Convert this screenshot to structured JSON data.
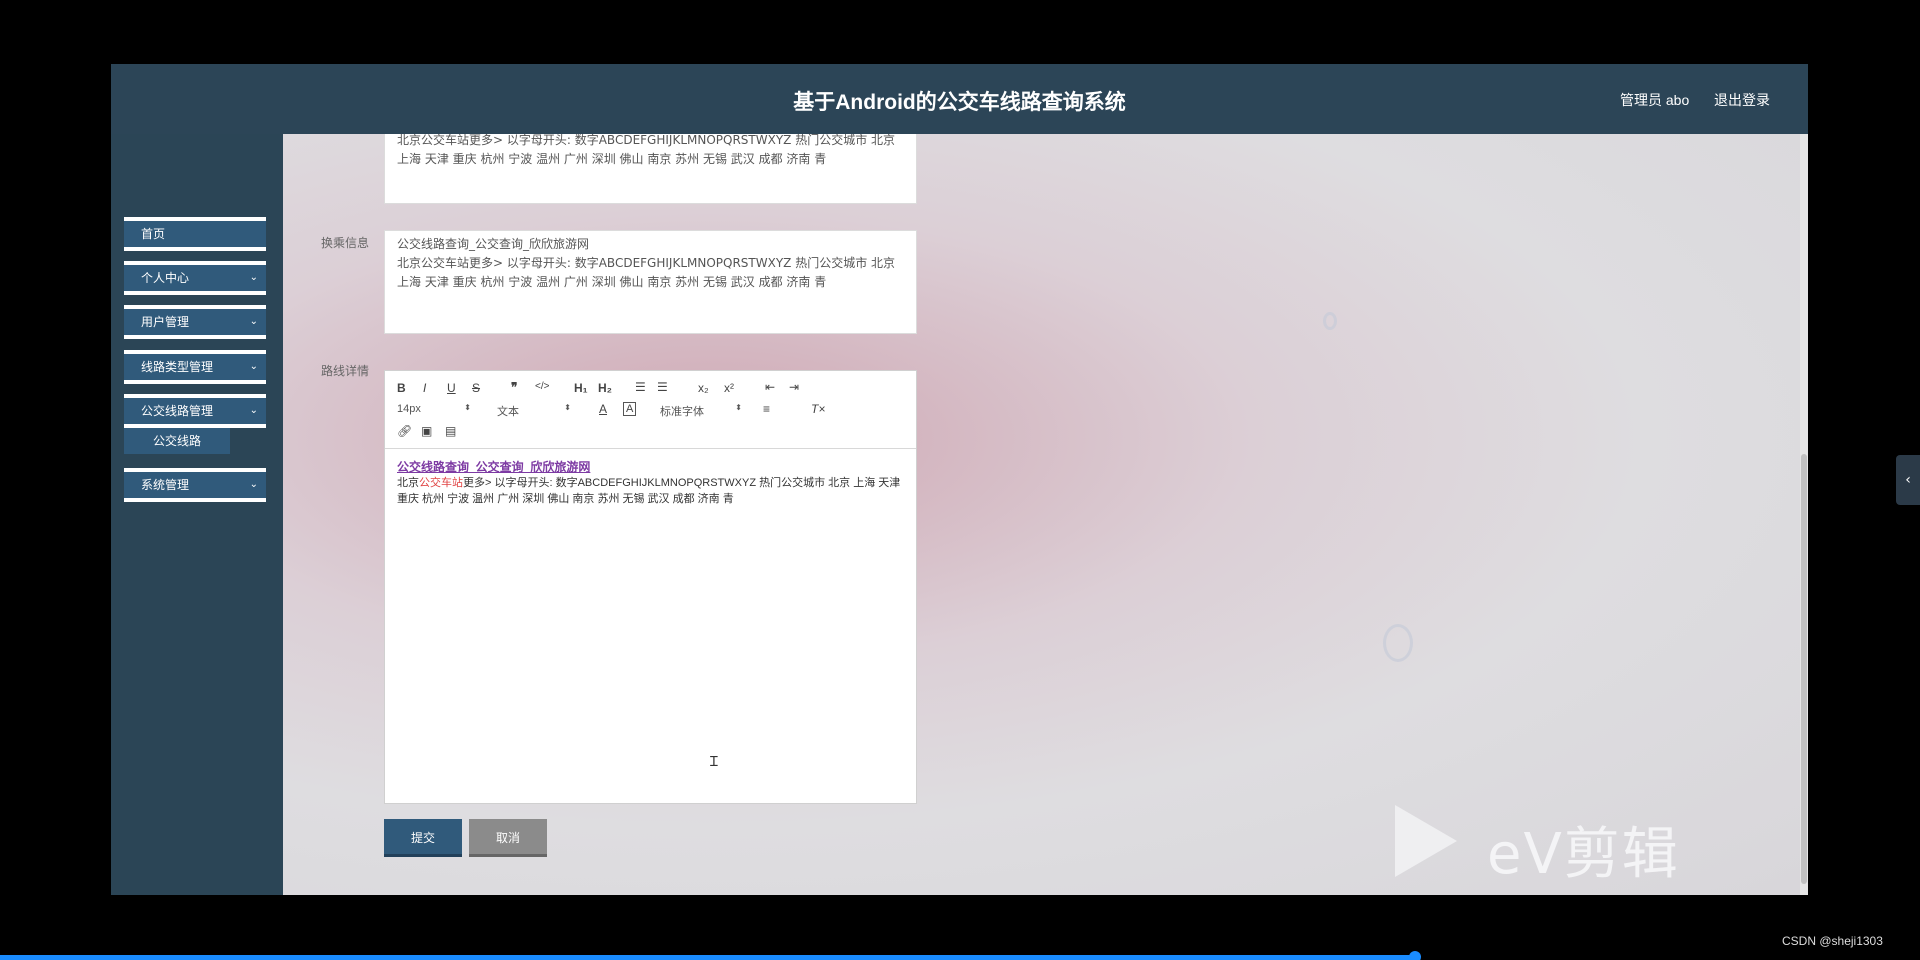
{
  "header": {
    "title": "基于Android的公交车线路查询系统",
    "user": "管理员 abo",
    "logout": "退出登录"
  },
  "sidebar": {
    "items": [
      {
        "label": "首页"
      },
      {
        "label": "个人中心"
      },
      {
        "label": "用户管理"
      },
      {
        "label": "线路类型管理"
      },
      {
        "label": "公交线路管理"
      },
      {
        "label": "系统管理"
      }
    ],
    "sub_item": "公交线路",
    "chevron": "⌄"
  },
  "form": {
    "field1_text": "北京公交车站更多> 以字母开头: 数字ABCDEFGHIJKLMNOPQRSTWXYZ 热门公交城市 北京 上海 天津 重庆 杭州 宁波 温州 广州 深圳 佛山 南京 苏州 无锡 武汉 成都 济南 青",
    "transfer_label": "换乘信息",
    "transfer_line1": "公交线路查询_公交查询_欣欣旅游网",
    "transfer_line2": "北京公交车站更多> 以字母开头: 数字ABCDEFGHIJKLMNOPQRSTWXYZ 热门公交城市 北京 上海 天津 重庆 杭州 宁波 温州 广州 深圳 佛山 南京 苏州 无锡 武汉 成都 济南 青",
    "detail_label": "路线详情"
  },
  "editor": {
    "font_size": "14px",
    "paragraph": "文本",
    "font_family": "标准字体",
    "heading": "公交线路查询_公交查询_欣欣旅游网",
    "line_prefix": "北京",
    "line_red": "公交车站",
    "line_rest": "更多> 以字母开头: 数字ABCDEFGHIJKLMNOPQRSTWXYZ 热门公交城市 北京 上海 天津 重庆 杭州 宁波 温州 广州 深圳 佛山 南京 苏州 无锡 武汉 成都 济南 青"
  },
  "buttons": {
    "submit": "提交",
    "cancel": "取消"
  },
  "watermark": "eV剪辑",
  "credit": "CSDN @sheji1303",
  "colors": {
    "header_bg": "#2c4557",
    "sidebar_bg": "#2b4556",
    "accent": "#305a7b"
  }
}
